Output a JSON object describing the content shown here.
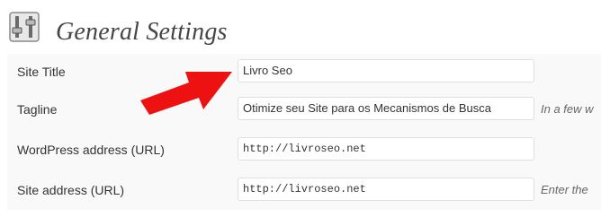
{
  "header": {
    "icon": "settings-sliders-icon",
    "title": "General Settings"
  },
  "fields": [
    {
      "label": "Site Title",
      "value": "Livro Seo",
      "description": ""
    },
    {
      "label": "Tagline",
      "value": "Otimize seu Site para os Mecanismos de Busca",
      "description": "In a few w"
    },
    {
      "label": "WordPress address (URL)",
      "value": "http://livroseo.net",
      "description": ""
    },
    {
      "label": "Site address (URL)",
      "value": "http://livroseo.net",
      "description": "Enter the"
    }
  ],
  "annotation": {
    "icon": "red-arrow-icon",
    "color": "#ee1111"
  },
  "colors": {
    "title": "#464646",
    "form_bg": "#f9f9f9",
    "input_border": "#dfdfdf"
  }
}
